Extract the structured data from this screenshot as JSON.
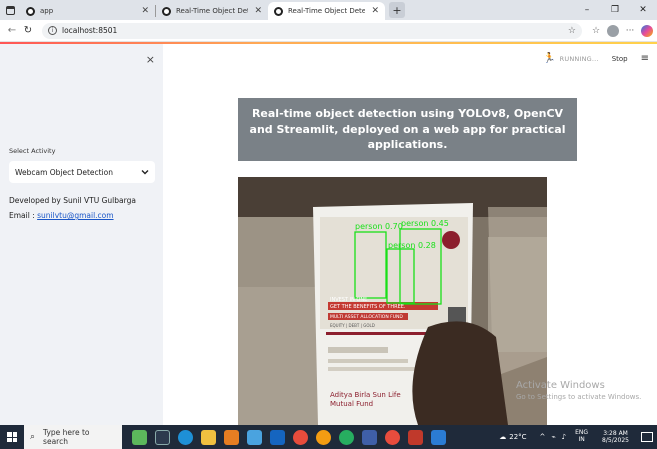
{
  "browser": {
    "tabs": [
      {
        "title": "app",
        "active": false
      },
      {
        "title": "Real-Time Object Detection",
        "active": false
      },
      {
        "title": "Real-Time Object Detection",
        "active": true
      }
    ],
    "new_tab": "+",
    "window_controls": {
      "minimize": "–",
      "restore": "❐",
      "close": "✕"
    },
    "url": "localhost:8501"
  },
  "sidebar": {
    "close": "×",
    "select_label": "Select Activity",
    "select_value": "Webcam Object Detection",
    "developer": "Developed by Sunil VTU Gulbarga",
    "email_prefix": "Email : ",
    "email": "sunilvtu@gmail.com"
  },
  "main": {
    "status": "RUNNING...",
    "stop": "Stop",
    "menu": "≡",
    "banner": "Real-time object detection using YOLOv8, OpenCV and Streamlit, deployed on a web app for practical applications.",
    "detections": [
      {
        "label": "person",
        "score": "0.70",
        "color": "#19e019"
      },
      {
        "label": "person",
        "score": "0.45",
        "color": "#19e019"
      },
      {
        "label": "person",
        "score": "0.28",
        "color": "#19e019"
      }
    ],
    "paper": {
      "line1": "INVEST IN ONE.",
      "line2": "GET THE BENEFITS OF THREE.",
      "line3": "MULTI ASSET ALLOCATION FUND",
      "line4": "EQUITY | DEBT | GOLD",
      "brand": "Aditya Birla Sun Life",
      "brand2": "Mutual Fund"
    }
  },
  "watermark": {
    "title": "Activate Windows",
    "subtitle": "Go to Settings to activate Windows."
  },
  "taskbar": {
    "search_placeholder": "Type here to search",
    "temperature": "22°C",
    "lang_top": "ENG",
    "lang_bottom": "IN",
    "time": "3:28 AM",
    "date": "8/5/2025"
  },
  "colors": {
    "sidebar_bg": "#f0f2f6",
    "banner_bg": "#7a8187",
    "detection_box": "#19e019",
    "taskbar_bg": "#1f2a3a",
    "link": "#1a56c7"
  }
}
